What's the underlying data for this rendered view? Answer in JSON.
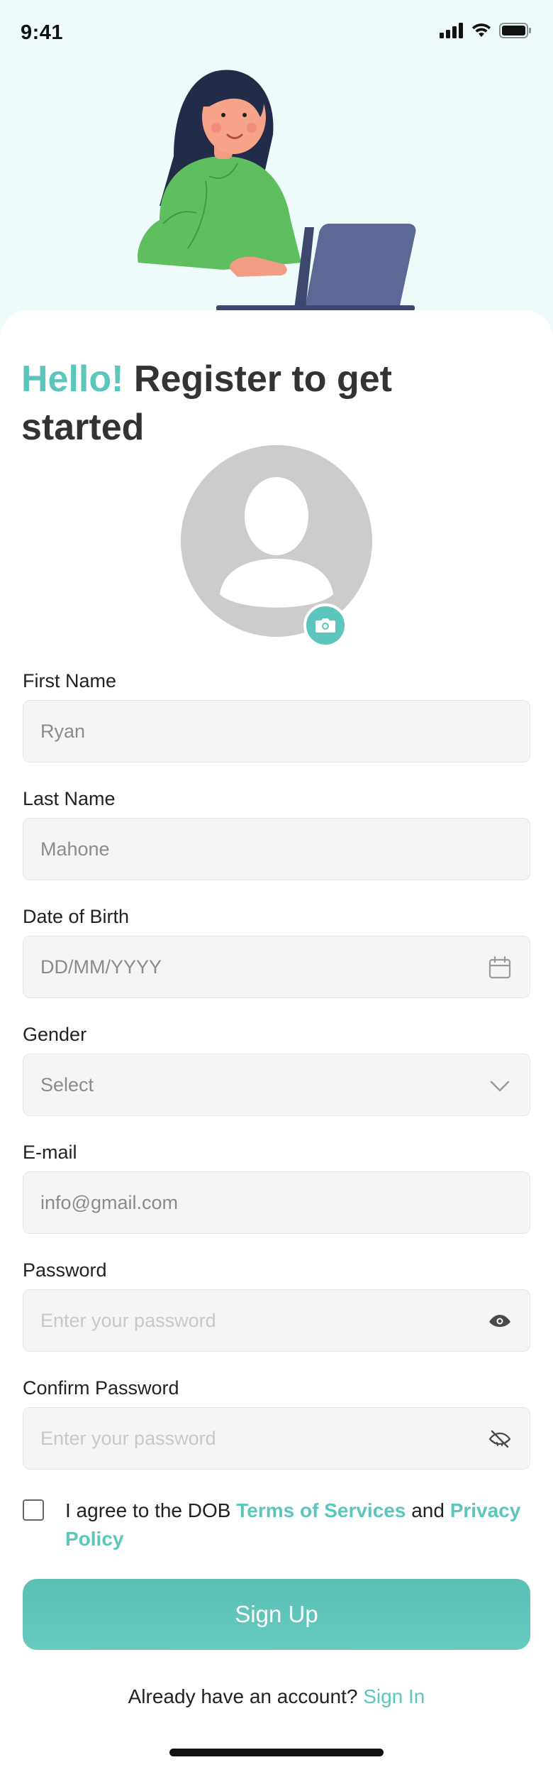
{
  "status_bar": {
    "time": "9:41"
  },
  "header": {
    "title_accent": "Hello!",
    "title_rest": " Register to get started"
  },
  "form": {
    "first_name": {
      "label": "First Name",
      "value": "Ryan"
    },
    "last_name": {
      "label": "Last Name",
      "value": "Mahone"
    },
    "dob": {
      "label": "Date of Birth",
      "placeholder": "DD/MM/YYYY"
    },
    "gender": {
      "label": "Gender",
      "value": "Select"
    },
    "email": {
      "label": "E-mail",
      "value": "info@gmail.com"
    },
    "password": {
      "label": "Password",
      "placeholder": "Enter your password"
    },
    "confirm_password": {
      "label": "Confirm Password",
      "placeholder": "Enter your password"
    }
  },
  "agreement": {
    "prefix": "I agree to the DOB ",
    "terms": "Terms of Services",
    "middle": " and ",
    "privacy": "Privacy Policy",
    "checked": false
  },
  "actions": {
    "signup_label": "Sign Up",
    "have_account": "Already have an account? ",
    "signin_label": "Sign In"
  },
  "colors": {
    "accent": "#5cc5bc",
    "top_bg": "#effbfb",
    "field_bg": "#f6f5f6"
  },
  "icons": [
    "signal-icon",
    "wifi-icon",
    "battery-icon",
    "camera-icon",
    "calendar-icon",
    "chevron-down-icon",
    "eye-icon",
    "eye-off-icon"
  ]
}
